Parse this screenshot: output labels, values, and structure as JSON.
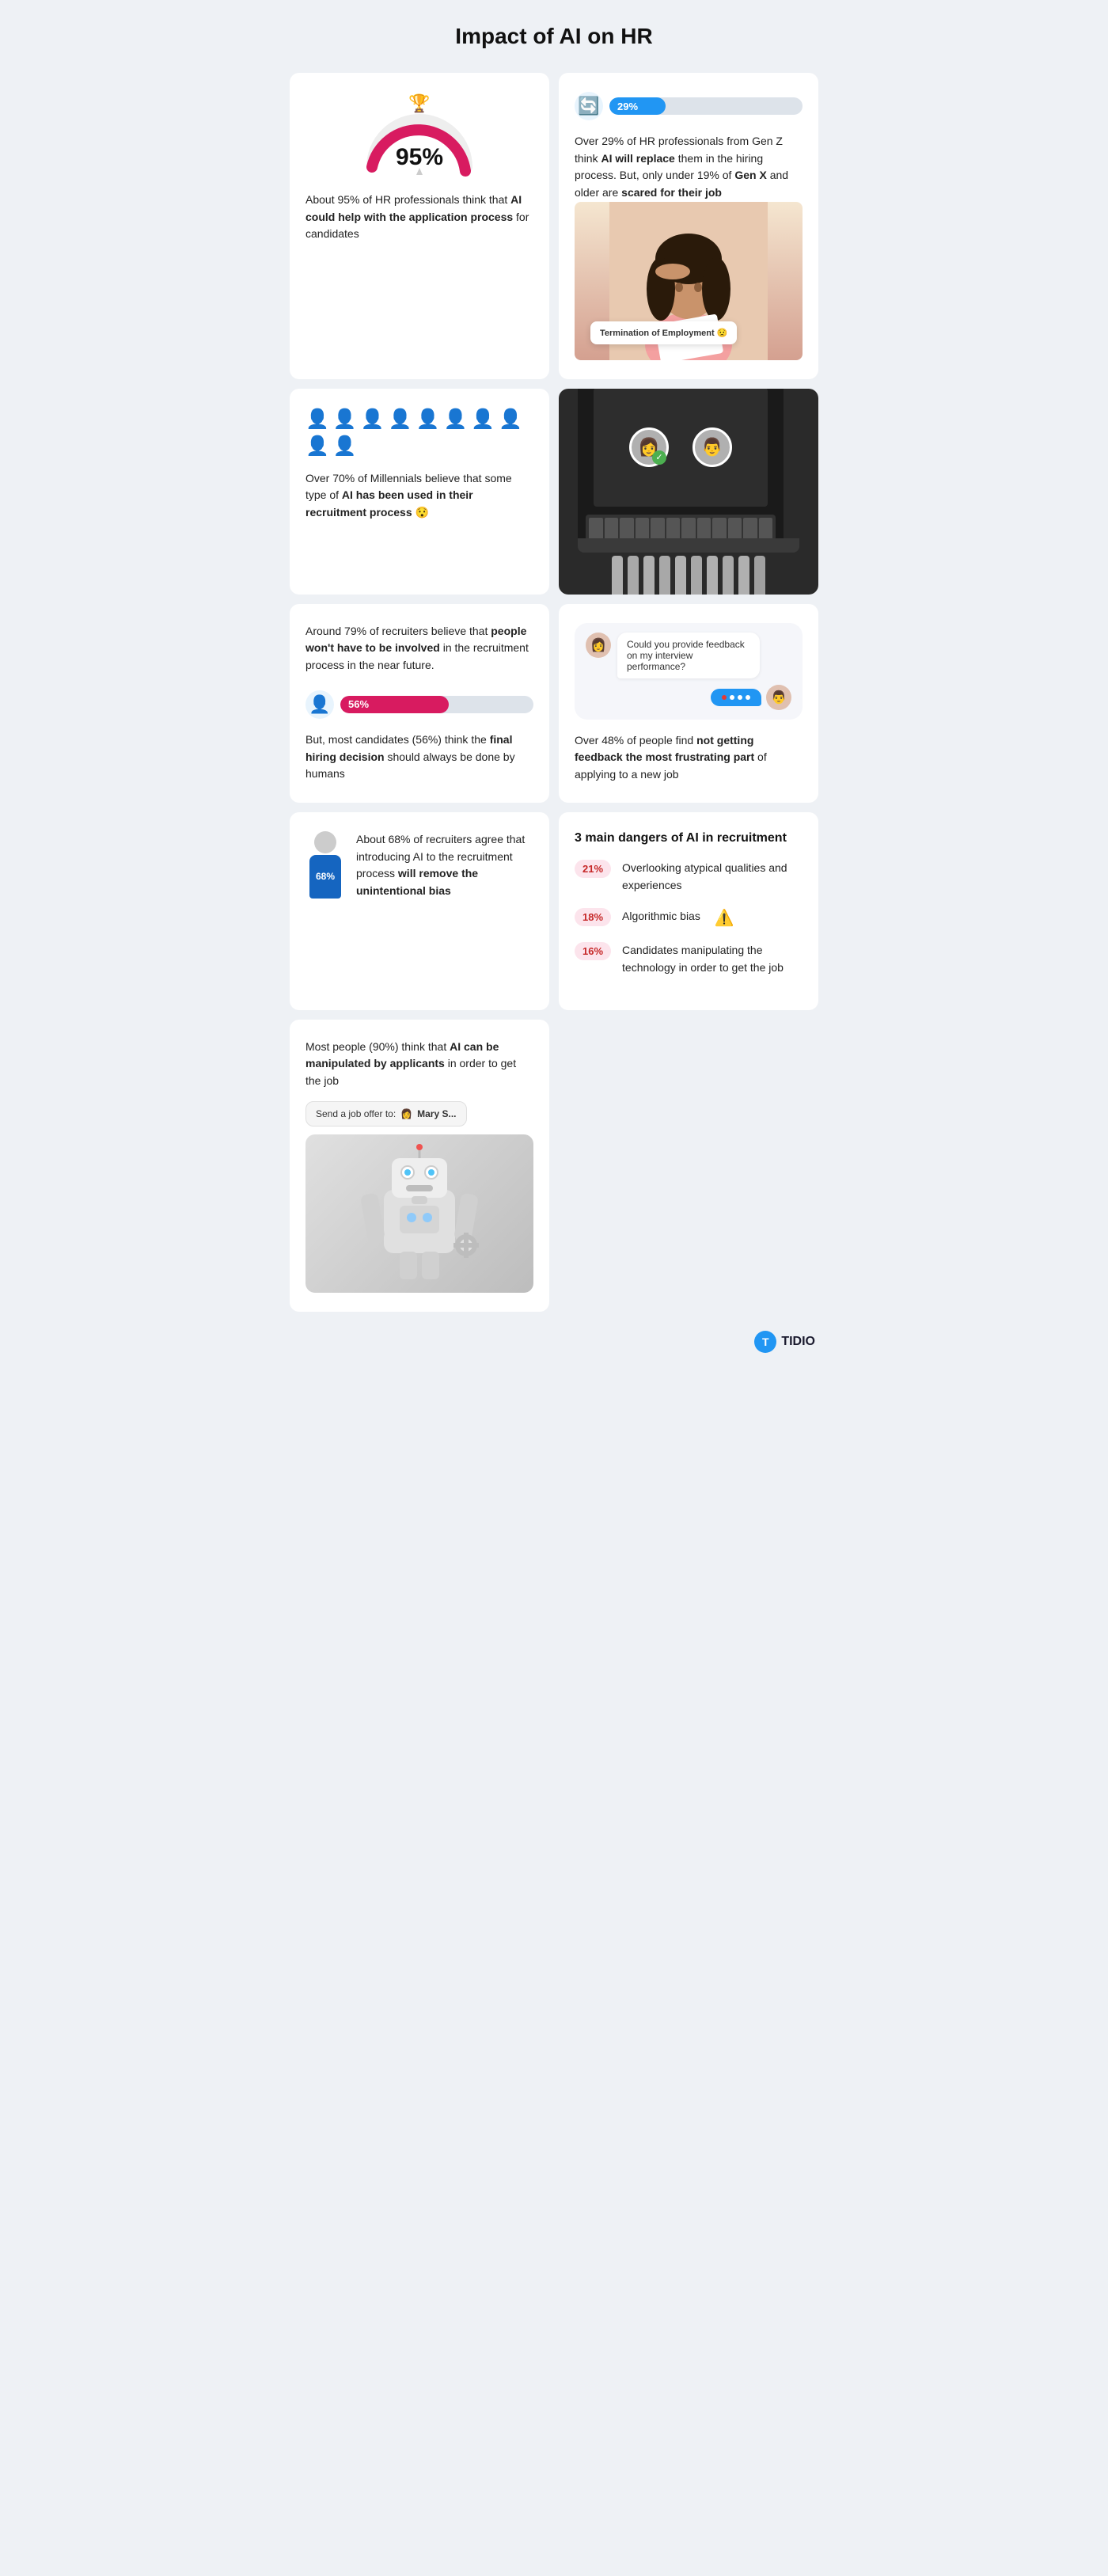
{
  "page": {
    "title": "Impact of AI on HR"
  },
  "card1": {
    "percent": "95%",
    "text_pre": "About 95% of HR professionals think that ",
    "text_bold": "AI could help with the application process",
    "text_post": " for candidates",
    "gauge_value": 95
  },
  "card2": {
    "bar_percent": "29%",
    "bar_fill": 29,
    "text_pre": "Over 29% of HR professionals from Gen Z think ",
    "text_bold1": "AI will replace",
    "text_mid": " them in the hiring process. But, only under 19% of ",
    "text_bold2": "Gen X",
    "text_post": " and older are ",
    "text_bold3": "scared for their job"
  },
  "card3": {
    "percent": "70%",
    "people_filled": 8,
    "people_total": 10,
    "text_pre": "Over 70% of Millennials believe that some type of ",
    "text_bold": "AI has been used in their recruitment process",
    "text_emoji": "😯"
  },
  "card4": {
    "termination_label": "Termination of Employment 😟",
    "image_desc": "Woman looking worried at paper"
  },
  "card5": {
    "image_desc": "Laptop with robot hands and candidate avatars",
    "checkmark": "✓"
  },
  "card6": {
    "text_pre": "Around 79% of recruiters believe that ",
    "text_bold": "people won't have to be involved",
    "text_post": " in the recruitment process in the near future.",
    "bar_percent": "56%",
    "bar_fill": 56,
    "text2_pre": "But, most candidates (56%) think the ",
    "text2_bold": "final hiring decision",
    "text2_post": " should always be done by humans"
  },
  "card7": {
    "chat_bubble": "Could you provide feedback on my interview performance?",
    "text_pre": "Over 48% of people find ",
    "text_bold": "not getting feedback the most frustrating part",
    "text_post": " of applying to a new job"
  },
  "card8": {
    "percent": "68%",
    "text_pre": "About 68% of recruiters agree that introducing AI to the recruitment process ",
    "text_bold": "will remove the unintentional bias"
  },
  "card9": {
    "section_title": "3 main dangers of AI in recruitment",
    "dangers": [
      {
        "pct": "21%",
        "text": "Overlooking atypical qualities and experiences"
      },
      {
        "pct": "18%",
        "text": "Algorithmic bias",
        "emoji": "⚠️"
      },
      {
        "pct": "16%",
        "text": "Candidates manipulating the technology in order to get the job"
      }
    ]
  },
  "card10": {
    "text_pre": "Most people (90%) think that ",
    "text_bold": "AI can be manipulated by applicants",
    "text_post": " in order to get the job",
    "job_offer_label": "Send a job offer to:",
    "name_label": "Mary S..."
  },
  "footer": {
    "brand": "TIDIO"
  }
}
